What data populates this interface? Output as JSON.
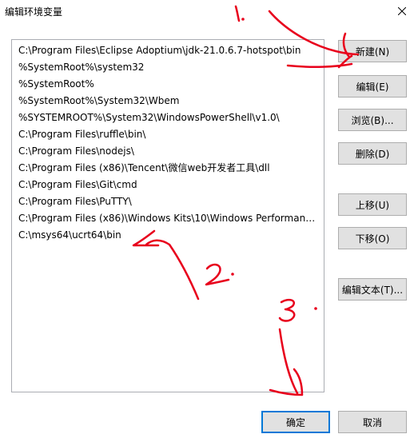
{
  "window": {
    "title": "编辑环境变量",
    "close_glyph": "✕"
  },
  "paths": [
    "C:\\Program Files\\Eclipse Adoptium\\jdk-21.0.6.7-hotspot\\bin",
    "%SystemRoot%\\system32",
    "%SystemRoot%",
    "%SystemRoot%\\System32\\Wbem",
    "%SYSTEMROOT%\\System32\\WindowsPowerShell\\v1.0\\",
    "C:\\Program Files\\ruffle\\bin\\",
    "C:\\Program Files\\nodejs\\",
    "C:\\Program Files (x86)\\Tencent\\微信web开发者工具\\dll",
    "C:\\Program Files\\Git\\cmd",
    "C:\\Program Files\\PuTTY\\",
    "C:\\Program Files (x86)\\Windows Kits\\10\\Windows Performance ...",
    "C:\\msys64\\ucrt64\\bin"
  ],
  "buttons": {
    "new": "新建(N)",
    "edit": "编辑(E)",
    "browse": "浏览(B)...",
    "delete": "删除(D)",
    "move_up": "上移(U)",
    "move_down": "下移(O)",
    "edit_text": "编辑文本(T)...",
    "ok": "确定",
    "cancel": "取消"
  },
  "annotations": {
    "mark_1": "1.",
    "mark_2": "2.",
    "mark_3": "3.",
    "ink_color": "#e8001c"
  }
}
